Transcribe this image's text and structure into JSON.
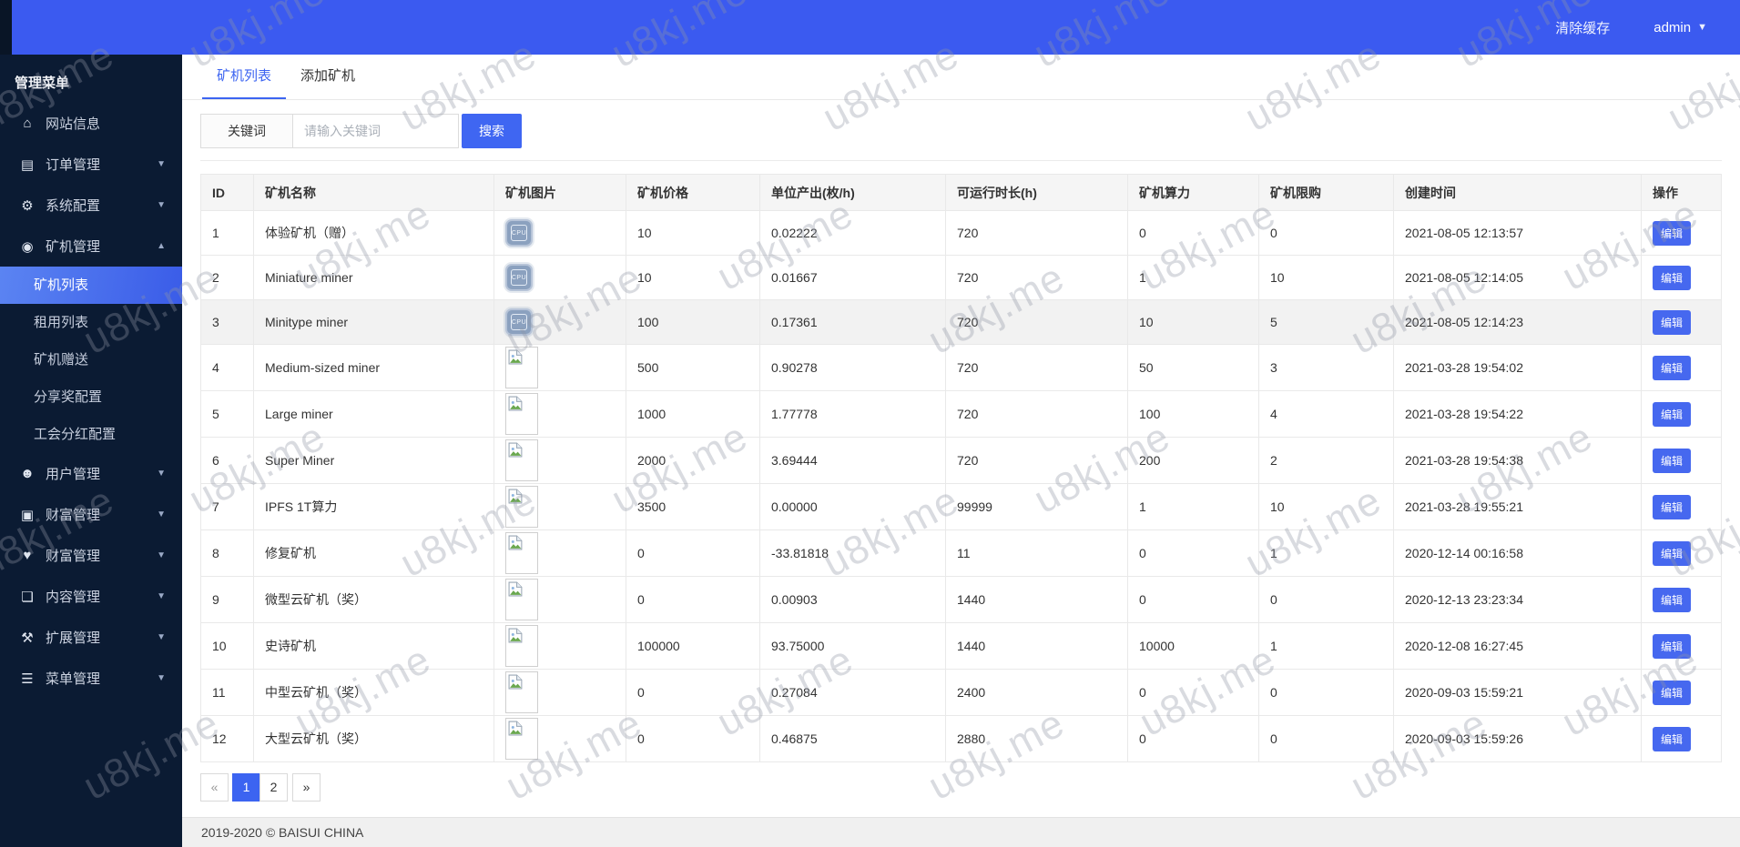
{
  "topbar": {
    "clear_cache": "清除缓存",
    "username": "admin"
  },
  "sidebar": {
    "title": "管理菜单",
    "items": [
      {
        "key": "site-info",
        "icon": "home-icon",
        "label": "网站信息",
        "arrow": null
      },
      {
        "key": "orders",
        "icon": "order-icon",
        "label": "订单管理",
        "arrow": "down"
      },
      {
        "key": "system-config",
        "icon": "gear-icon",
        "label": "系统配置",
        "arrow": "down"
      },
      {
        "key": "miner-mgmt",
        "icon": "miner-icon",
        "label": "矿机管理",
        "arrow": "up",
        "children": [
          {
            "key": "miner-list",
            "label": "矿机列表",
            "active": true
          },
          {
            "key": "rental-list",
            "label": "租用列表"
          },
          {
            "key": "miner-gift",
            "label": "矿机赠送"
          },
          {
            "key": "share-reward-config",
            "label": "分享奖配置"
          },
          {
            "key": "union-dividend-config",
            "label": "工会分红配置"
          }
        ]
      },
      {
        "key": "user-mgmt",
        "icon": "users-icon",
        "label": "用户管理",
        "arrow": "down"
      },
      {
        "key": "wealth-mgmt-1",
        "icon": "money-icon",
        "label": "财富管理",
        "arrow": "down"
      },
      {
        "key": "wealth-mgmt-2",
        "icon": "heart-icon",
        "label": "财富管理",
        "arrow": "down"
      },
      {
        "key": "content-mgmt",
        "icon": "doc-icon",
        "label": "内容管理",
        "arrow": "down"
      },
      {
        "key": "extension-mgmt",
        "icon": "wrench-icon",
        "label": "扩展管理",
        "arrow": "down"
      },
      {
        "key": "menu-mgmt",
        "icon": "menu-icon",
        "label": "菜单管理",
        "arrow": "down"
      }
    ]
  },
  "tabs": [
    {
      "key": "miner-list",
      "label": "矿机列表",
      "active": true
    },
    {
      "key": "add-miner",
      "label": "添加矿机",
      "active": false
    }
  ],
  "search": {
    "label": "关键词",
    "placeholder": "请输入关键词",
    "button": "搜索"
  },
  "table": {
    "headers": [
      "ID",
      "矿机名称",
      "矿机图片",
      "矿机价格",
      "单位产出(枚/h)",
      "可运行时长(h)",
      "矿机算力",
      "矿机限购",
      "创建时间",
      "操作"
    ],
    "edit_label": "编辑",
    "cpu_icon_label": "CPU",
    "rows": [
      {
        "id": "1",
        "name": "体验矿机（赠）",
        "image": "cpu-chip",
        "price": "10",
        "output": "0.02222",
        "runtime": "720",
        "power": "0",
        "limit": "0",
        "created": "2021-08-05 12:13:57"
      },
      {
        "id": "2",
        "name": "Miniature miner",
        "image": "cpu-chip",
        "price": "10",
        "output": "0.01667",
        "runtime": "720",
        "power": "1",
        "limit": "10",
        "created": "2021-08-05 12:14:05"
      },
      {
        "id": "3",
        "name": "Minitype miner",
        "image": "cpu-chip",
        "price": "100",
        "output": "0.17361",
        "runtime": "720",
        "power": "10",
        "limit": "5",
        "created": "2021-08-05 12:14:23",
        "highlight": true
      },
      {
        "id": "4",
        "name": "Medium-sized miner",
        "image": "broken",
        "price": "500",
        "output": "0.90278",
        "runtime": "720",
        "power": "50",
        "limit": "3",
        "created": "2021-03-28 19:54:02"
      },
      {
        "id": "5",
        "name": "Large miner",
        "image": "broken",
        "price": "1000",
        "output": "1.77778",
        "runtime": "720",
        "power": "100",
        "limit": "4",
        "created": "2021-03-28 19:54:22"
      },
      {
        "id": "6",
        "name": "Super Miner",
        "image": "broken",
        "price": "2000",
        "output": "3.69444",
        "runtime": "720",
        "power": "200",
        "limit": "2",
        "created": "2021-03-28 19:54:38"
      },
      {
        "id": "7",
        "name": "IPFS 1T算力",
        "image": "broken",
        "price": "3500",
        "output": "0.00000",
        "runtime": "99999",
        "power": "1",
        "limit": "10",
        "created": "2021-03-28 19:55:21"
      },
      {
        "id": "8",
        "name": "修复矿机",
        "image": "broken",
        "price": "0",
        "output": "-33.81818",
        "runtime": "11",
        "power": "0",
        "limit": "1",
        "created": "2020-12-14 00:16:58"
      },
      {
        "id": "9",
        "name": "微型云矿机（奖）",
        "image": "broken",
        "price": "0",
        "output": "0.00903",
        "runtime": "1440",
        "power": "0",
        "limit": "0",
        "created": "2020-12-13 23:23:34"
      },
      {
        "id": "10",
        "name": "史诗矿机",
        "image": "broken",
        "price": "100000",
        "output": "93.75000",
        "runtime": "1440",
        "power": "10000",
        "limit": "1",
        "created": "2020-12-08 16:27:45"
      },
      {
        "id": "11",
        "name": "中型云矿机（奖）",
        "image": "broken",
        "price": "0",
        "output": "0.27084",
        "runtime": "2400",
        "power": "0",
        "limit": "0",
        "created": "2020-09-03 15:59:21"
      },
      {
        "id": "12",
        "name": "大型云矿机（奖）",
        "image": "broken",
        "price": "0",
        "output": "0.46875",
        "runtime": "2880",
        "power": "0",
        "limit": "0",
        "created": "2020-09-03 15:59:26"
      }
    ]
  },
  "pagination": {
    "prev": "«",
    "pages": [
      "1",
      "2"
    ],
    "active": "1",
    "next": "»"
  },
  "footer": {
    "copyright": "2019-2020 © BAISUI CHINA"
  },
  "watermark": {
    "text": "u8kj.me"
  },
  "colors": {
    "accent": "#3c64f1",
    "topbar": "#3b5af0",
    "sidebar": "#0b1b33",
    "active_item_gradient": [
      "#5b84f2",
      "#3a5ce8"
    ]
  }
}
